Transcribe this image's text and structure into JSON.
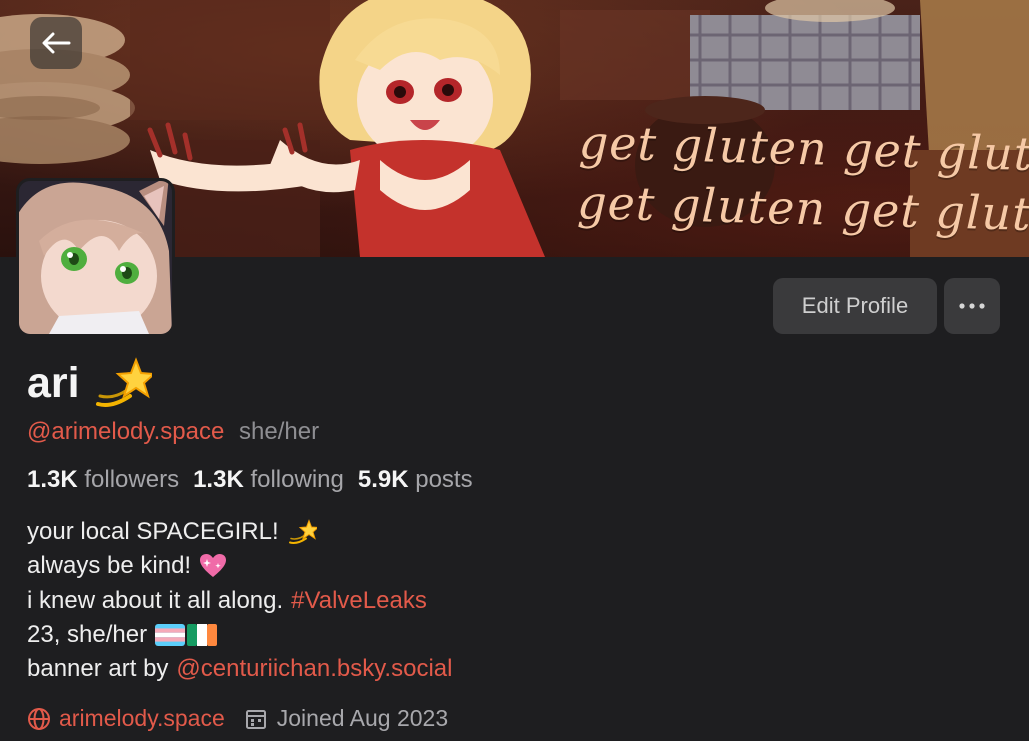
{
  "banner": {
    "text_line_1": "get gluten get gluten",
    "text_line_2": "get gluten get gluten"
  },
  "header": {
    "back_icon": "arrow-left-icon"
  },
  "actions": {
    "edit_profile_label": "Edit Profile",
    "more_icon": "ellipsis-icon"
  },
  "profile": {
    "display_name": "ari",
    "name_emoji": "dizzy-emoji",
    "handle": "@arimelody.space",
    "pronouns": "she/her"
  },
  "stats": {
    "followers_count": "1.3K",
    "followers_label": "followers",
    "following_count": "1.3K",
    "following_label": "following",
    "posts_count": "5.9K",
    "posts_label": "posts"
  },
  "bio": {
    "line1": "your local SPACEGIRL!",
    "line2": "always be kind!",
    "line3_text": "i knew about it all along.",
    "line3_hashtag": "#ValveLeaks",
    "line4": "23, she/her",
    "line5_text": "banner art by",
    "line5_mention": "@centuriichan.bsky.social"
  },
  "meta": {
    "website_icon": "globe-icon",
    "website": "arimelody.space",
    "joined_icon": "calendar-icon",
    "joined": "Joined Aug 2023"
  },
  "colors": {
    "background": "#1e1e20",
    "accent_link": "#e25a4a",
    "button_bg": "#3a3a3c",
    "muted_text": "#a6a6aa"
  }
}
